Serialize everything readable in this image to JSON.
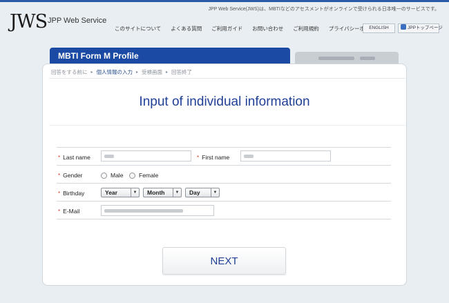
{
  "header": {
    "logo": "JWS",
    "logo_sub": "JPP Web Service",
    "tagline": "JPP Web Service(JWS)は、MBTIなどのアセスメントがオンラインで受けられる日本唯一のサービスです。",
    "nav": [
      "このサイトについて",
      "よくある質問",
      "ご利用ガイド",
      "お問い合わせ",
      "ご利用規約",
      "プライバシーポリシー"
    ],
    "english_button": "ENGLISH",
    "jpp_top_button": "JPPトップページ"
  },
  "tabs": {
    "active_label": "MBTI Form M Profile"
  },
  "breadcrumb": [
    "回答をする前に",
    "個人情報の入力",
    "受検画面",
    "回答終了"
  ],
  "page_title": "Input of individual information",
  "form": {
    "required_mark": "*",
    "last_name_label": "Last name",
    "first_name_label": "First name",
    "gender_label": "Gender",
    "gender_male": "Male",
    "gender_female": "Female",
    "birthday_label": "Birthday",
    "year_select": "Year",
    "month_select": "Month",
    "day_select": "Day",
    "email_label": "E-Mail"
  },
  "next_button": "NEXT",
  "colors": {
    "accent": "#1a4aa3",
    "title": "#203f95",
    "required": "#d23a2a"
  }
}
